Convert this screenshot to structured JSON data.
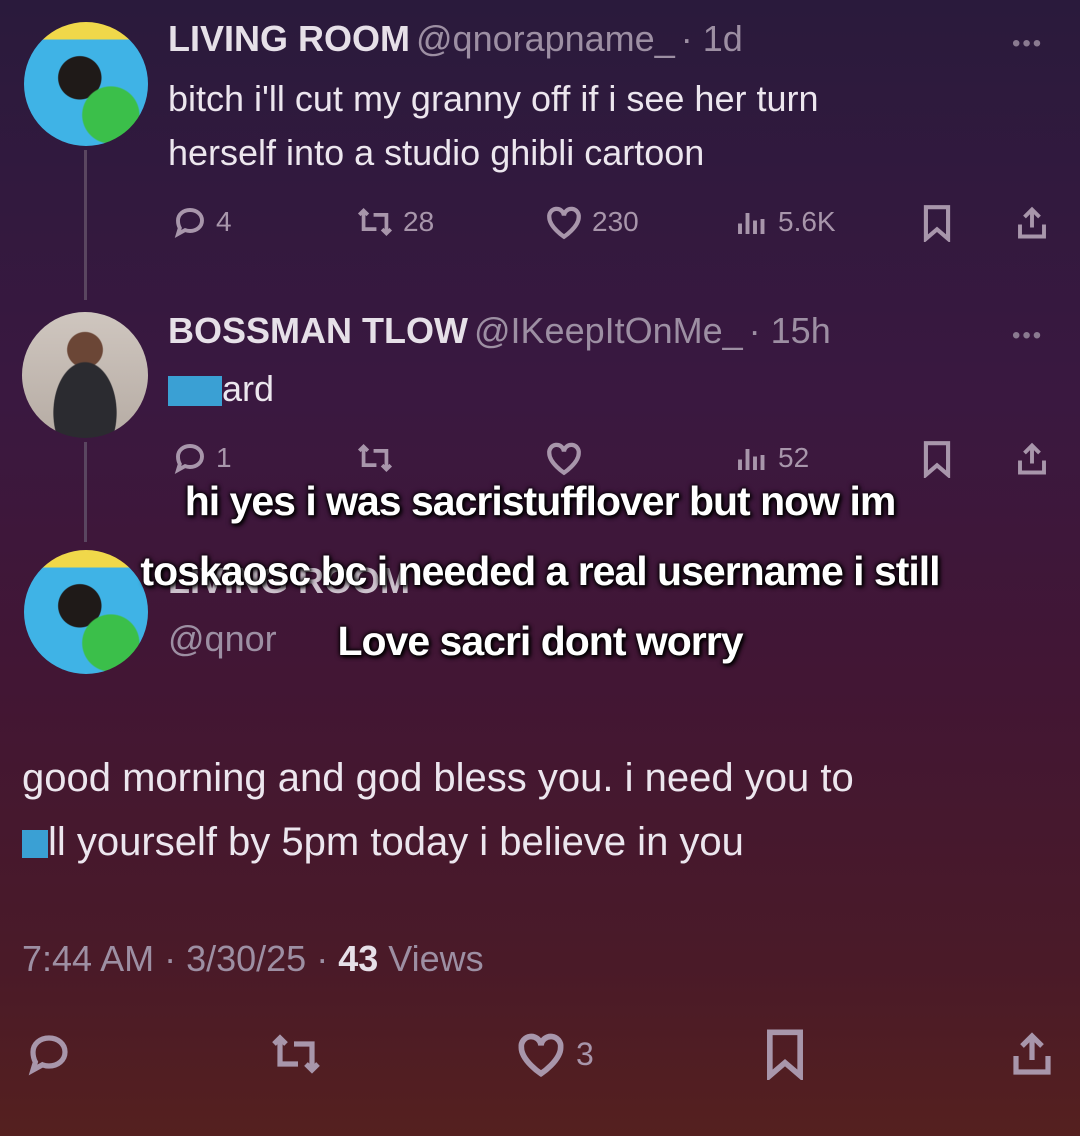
{
  "tweets": [
    {
      "name": "LIVING ROOM",
      "handle": "@qnorapname_",
      "time": "· 1d",
      "text_line1": "bitch i'll cut my granny off if i see her turn",
      "text_line2": "herself into a studio ghibli cartoon",
      "replies": "4",
      "reposts": "28",
      "likes": "230",
      "views": "5.6K"
    },
    {
      "name": "BOSSMAN TLOW",
      "handle": "@IKeepItOnMe_",
      "time": "· 15h",
      "text_suffix": "ard",
      "replies": "1",
      "views": "52"
    }
  ],
  "main_tweet": {
    "name_partial": "LIVING ROOM",
    "handle": "@qnor",
    "text_line1": "good morning and god bless you. i need you to",
    "text_line2_suffix": "ll yourself by 5pm today i believe in you",
    "time": "7:44 AM · 3/30/25 · ",
    "views_count": "43",
    "views_label": " Views",
    "likes": "3"
  },
  "caption": {
    "line1": "hi yes i was sacristufflover but now im",
    "line2": "toskaosc bc i needed a real username i still",
    "line3": "Love sacri dont worry"
  },
  "icons": [
    "reply-icon",
    "repost-icon",
    "like-icon",
    "views-icon",
    "bookmark-icon",
    "share-icon",
    "more-icon"
  ]
}
